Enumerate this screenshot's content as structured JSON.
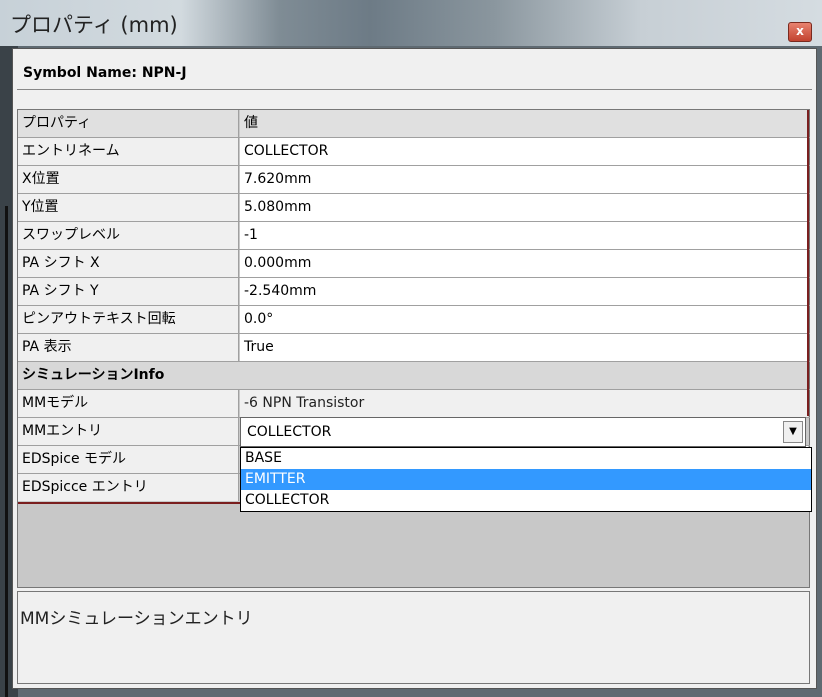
{
  "window": {
    "title": "プロパティ (mm)",
    "close_glyph": "x"
  },
  "symbol": {
    "label": "Symbol Name: NPN-J"
  },
  "grid": {
    "headers": [
      "プロパティ",
      "値"
    ],
    "rows": [
      {
        "name": "エントリネーム",
        "value": "COLLECTOR"
      },
      {
        "name": "X位置",
        "value": "7.620mm"
      },
      {
        "name": "Y位置",
        "value": "5.080mm"
      },
      {
        "name": "スワップレベル",
        "value": "-1"
      },
      {
        "name": "PA シフト X",
        "value": "0.000mm"
      },
      {
        "name": "PA シフト Y",
        "value": "-2.540mm"
      },
      {
        "name": "ピンアウトテキスト回転",
        "value": "0.0°"
      },
      {
        "name": "PA 表示",
        "value": "True"
      }
    ],
    "section": "シミュレーションInfo",
    "sim_rows": [
      {
        "name": "MMモデル",
        "value": "-6 NPN Transistor"
      },
      {
        "name": "MMエントリ",
        "value": "COLLECTOR"
      },
      {
        "name": "EDSpice モデル",
        "value": ""
      },
      {
        "name": "EDSpicce エントリ",
        "value": ""
      }
    ]
  },
  "dropdown": {
    "options": [
      "BASE",
      "EMITTER",
      "COLLECTOR"
    ],
    "highlighted": "EMITTER",
    "arrow_glyph": "▼"
  },
  "description": {
    "text": "MMシミュレーションエントリ"
  }
}
